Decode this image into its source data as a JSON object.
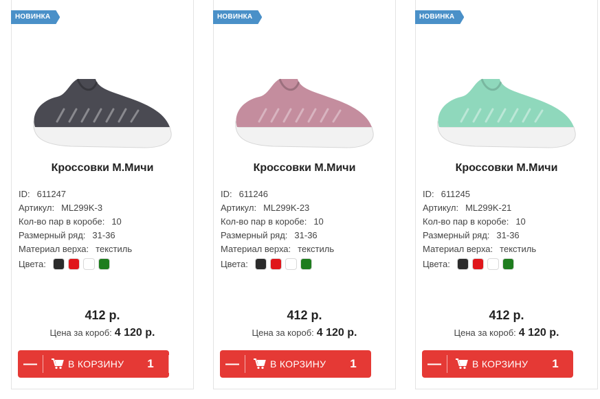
{
  "products": [
    {
      "badge": "НОВИНКА",
      "image": "sneaker-dark-gray",
      "shoe_color": "#4a4a52",
      "title": "Кроссовки М.Мичи",
      "id_label": "ID:",
      "id_value": "611247",
      "article_label": "Артикул:",
      "article_value": "ML299K-3",
      "pairs_label": "Кол-во пар в коробе:",
      "pairs_value": "10",
      "size_label": "Размерный ряд:",
      "size_value": "31-36",
      "material_label": "Материал верха:",
      "material_value": "текстиль",
      "colors_label": "Цвета:",
      "colors": [
        "#2b2b2b",
        "#e0161b",
        "#ffffff",
        "#1e7d1e"
      ],
      "price": "412 р.",
      "box_price_label": "Цена за короб:",
      "box_price_value": "4 120 р.",
      "cart_minus": "—",
      "cart_label": "В КОРЗИНУ",
      "cart_qty": "1"
    },
    {
      "badge": "НОВИНКА",
      "image": "sneaker-pink",
      "shoe_color": "#c48d9e",
      "title": "Кроссовки М.Мичи",
      "id_label": "ID:",
      "id_value": "611246",
      "article_label": "Артикул:",
      "article_value": "ML299K-23",
      "pairs_label": "Кол-во пар в коробе:",
      "pairs_value": "10",
      "size_label": "Размерный ряд:",
      "size_value": "31-36",
      "material_label": "Материал верха:",
      "material_value": "текстиль",
      "colors_label": "Цвета:",
      "colors": [
        "#2b2b2b",
        "#e0161b",
        "#ffffff",
        "#1e7d1e"
      ],
      "price": "412 р.",
      "box_price_label": "Цена за короб:",
      "box_price_value": "4 120 р.",
      "cart_minus": "—",
      "cart_label": "В КОРЗИНУ",
      "cart_qty": "1"
    },
    {
      "badge": "НОВИНКА",
      "image": "sneaker-mint",
      "shoe_color": "#8fd8bc",
      "title": "Кроссовки М.Мичи",
      "id_label": "ID:",
      "id_value": "611245",
      "article_label": "Артикул:",
      "article_value": "ML299K-21",
      "pairs_label": "Кол-во пар в коробе:",
      "pairs_value": "10",
      "size_label": "Размерный ряд:",
      "size_value": "31-36",
      "material_label": "Материал верха:",
      "material_value": "текстиль",
      "colors_label": "Цвета:",
      "colors": [
        "#2b2b2b",
        "#e0161b",
        "#ffffff",
        "#1e7d1e"
      ],
      "price": "412 р.",
      "box_price_label": "Цена за короб:",
      "box_price_value": "4 120 р.",
      "cart_minus": "—",
      "cart_label": "В КОРЗИНУ",
      "cart_qty": "1"
    }
  ]
}
